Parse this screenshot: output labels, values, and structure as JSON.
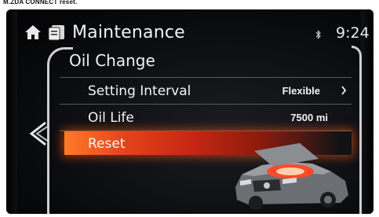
{
  "caption": "M.ZDA CONNECT reset.",
  "header": {
    "title": "Maintenance",
    "time": "9:24",
    "icons": [
      "home-icon",
      "maintenance-icon",
      "bluetooth-icon"
    ]
  },
  "menu": {
    "section_title": "Oil Change",
    "items": [
      {
        "label": "Setting Interval",
        "value": "Flexible",
        "icon": "chevron-right-icon"
      },
      {
        "label": "Oil Life",
        "value": "7500 mi"
      },
      {
        "label": "Reset",
        "selected": true
      }
    ]
  },
  "colors": {
    "selection": "#d8341a",
    "text": "#f2f2f2",
    "background": "#0b0c0e"
  }
}
